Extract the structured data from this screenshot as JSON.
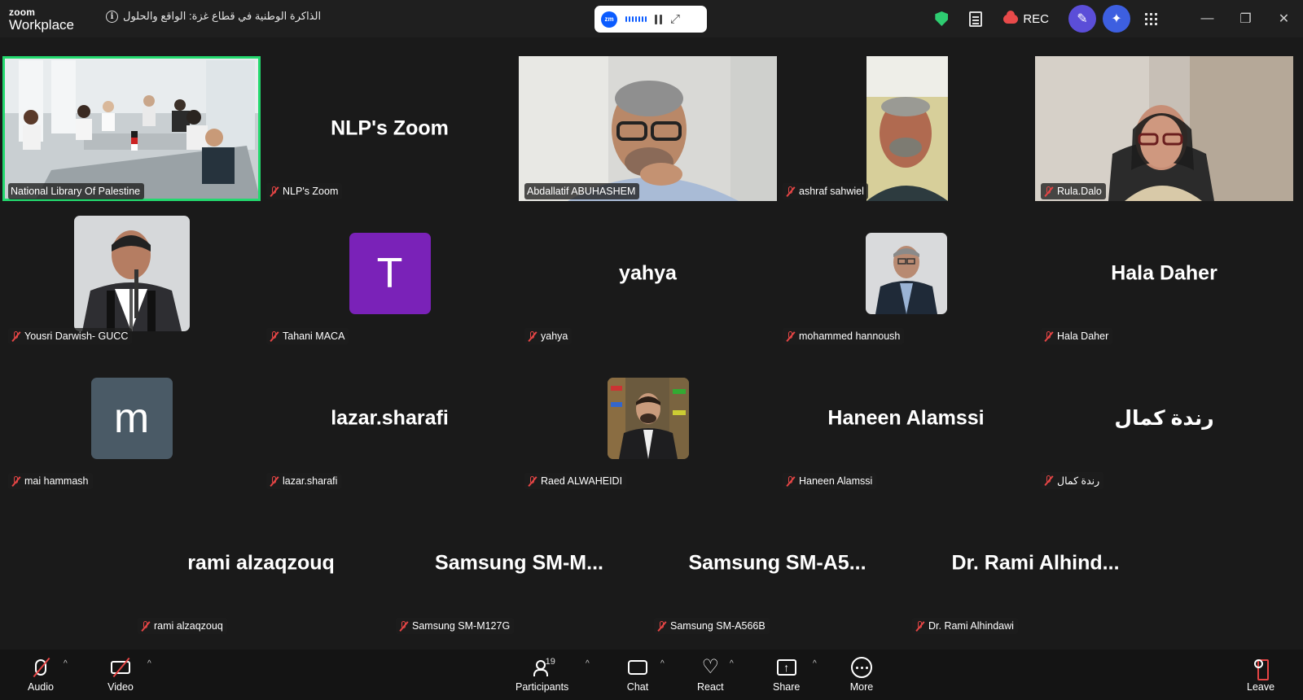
{
  "app": {
    "logo_line1": "zoom",
    "logo_line2": "Workplace"
  },
  "meeting": {
    "title": "الذاكرة الوطنية في قطاع غزة: الواقع والحلول"
  },
  "header": {
    "rec_label": "REC",
    "zm_badge": "zm"
  },
  "tiles": [
    {
      "name": "National Library Of Palestine",
      "display": "",
      "kind": "video"
    },
    {
      "name": "NLP's Zoom",
      "display": "NLP's Zoom",
      "kind": "text"
    },
    {
      "name": "Abdallatif ABUHASHEM",
      "display": "",
      "kind": "video"
    },
    {
      "name": "ashraf sahwiel",
      "display": "",
      "kind": "video"
    },
    {
      "name": "Rula.Dalo",
      "display": "",
      "kind": "video"
    },
    {
      "name": "Yousri Darwish- GUCC",
      "display": "",
      "kind": "photo"
    },
    {
      "name": "Tahani MACA",
      "display": "T",
      "kind": "avatar",
      "color": "#7a22b8"
    },
    {
      "name": "yahya",
      "display": "yahya",
      "kind": "text"
    },
    {
      "name": "mohammed hannoush",
      "display": "",
      "kind": "photo"
    },
    {
      "name": "Hala Daher",
      "display": "Hala Daher",
      "kind": "text"
    },
    {
      "name": "mai hammash",
      "display": "m",
      "kind": "avatar",
      "color": "#4a5a66"
    },
    {
      "name": "lazar.sharafi",
      "display": "lazar.sharafi",
      "kind": "text"
    },
    {
      "name": "Raed ALWAHEIDI",
      "display": "",
      "kind": "photo"
    },
    {
      "name": "Haneen Alamssi",
      "display": "Haneen Alamssi",
      "kind": "text"
    },
    {
      "name": "رندة كمال",
      "display": "رندة كمال",
      "kind": "text"
    },
    {
      "name": "rami alzaqzouq",
      "display": "rami alzaqzouq",
      "kind": "text"
    },
    {
      "name": "Samsung SM-M127G",
      "display": "Samsung SM-M...",
      "kind": "text"
    },
    {
      "name": "Samsung SM-A566B",
      "display": "Samsung SM-A5...",
      "kind": "text"
    },
    {
      "name": "Dr. Rami Alhindawi",
      "display": "Dr. Rami Alhind...",
      "kind": "text"
    }
  ],
  "toolbar": {
    "audio": "Audio",
    "video": "Video",
    "participants": "Participants",
    "participants_count": "19",
    "chat": "Chat",
    "react": "React",
    "share": "Share",
    "more": "More",
    "leave": "Leave"
  },
  "icons": {
    "shield": "shield-icon",
    "notes": "notes-icon",
    "cloud": "cloud-record-icon",
    "apps": "apps-grid-icon",
    "mic_off": "mic-muted-icon"
  },
  "colors": {
    "active_speaker": "#23d96e",
    "muted": "#e64545",
    "zoom_blue": "#0b5cff"
  }
}
